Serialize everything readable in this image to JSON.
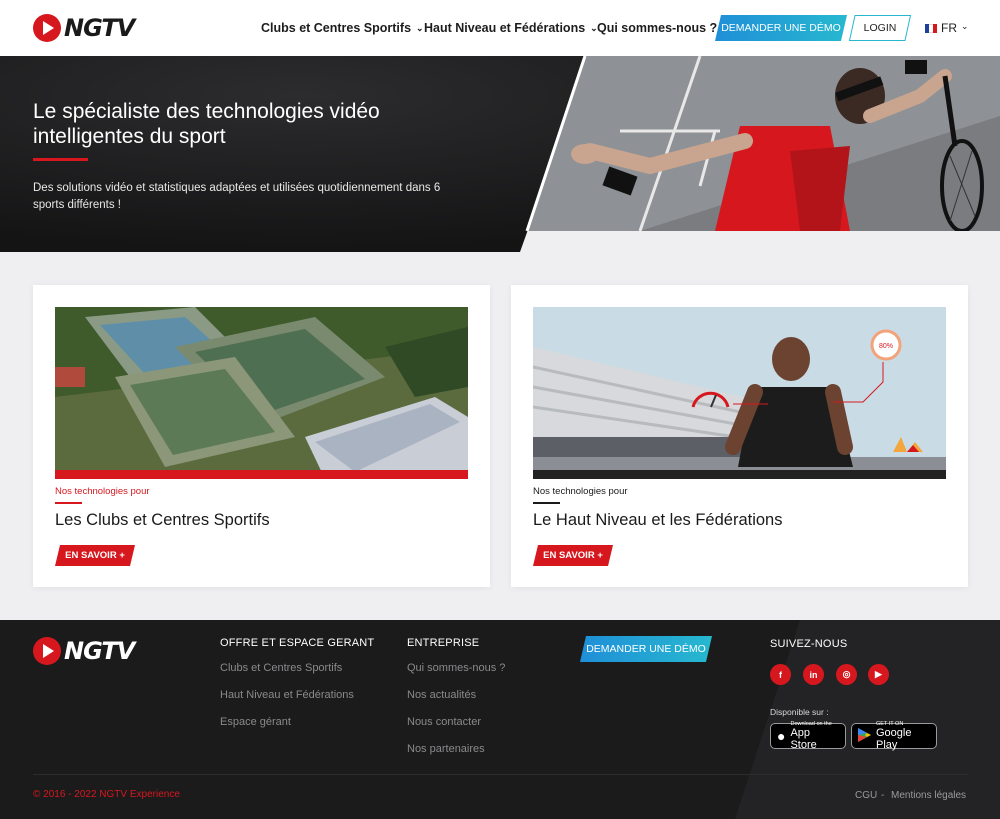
{
  "header": {
    "logo_text": "NGTV",
    "nav": [
      {
        "label": "Clubs et Centres Sportifs"
      },
      {
        "label": "Haut Niveau et Fédérations"
      },
      {
        "label": "Qui sommes-nous ?"
      }
    ],
    "demo_label": "DEMANDER UNE DÉMO",
    "login_label": "LOGIN",
    "language": "FR"
  },
  "hero": {
    "title": "Le spécialiste des technologies vidéo intelligentes du sport",
    "subtitle": "Des solutions vidéo et statistiques adaptées et utilisées quotidiennement dans 6 sports différents !"
  },
  "cards": [
    {
      "kicker": "Nos technologies pour",
      "title": "Les Clubs et Centres Sportifs",
      "button": "EN SAVOIR +"
    },
    {
      "kicker": "Nos technologies pour",
      "title": "Le Haut Niveau et les Fédérations",
      "button": "EN SAVOIR +",
      "gauge_label": "80%"
    }
  ],
  "footer": {
    "logo_text": "NGTV",
    "offre": {
      "heading": "OFFRE ET ESPACE GERANT",
      "links": [
        "Clubs et Centres Sportifs",
        "Haut Niveau et Fédérations",
        "Espace gérant"
      ]
    },
    "entreprise": {
      "heading": "ENTREPRISE",
      "links": [
        "Qui sommes-nous ?",
        "Nos actualités",
        "Nous contacter",
        "Nos partenaires"
      ]
    },
    "demo_label": "DEMANDER UNE DÉMO",
    "follow_heading": "SUIVEZ-NOUS",
    "social": [
      {
        "icon": "facebook-icon",
        "glyph": "f"
      },
      {
        "icon": "linkedin-icon",
        "glyph": "in"
      },
      {
        "icon": "instagram-icon",
        "glyph": "◎"
      },
      {
        "icon": "youtube-icon",
        "glyph": "▶"
      }
    ],
    "available_label": "Disponible sur :",
    "app_store": {
      "small": "Download on the",
      "big": "App Store"
    },
    "google_play": {
      "small": "GET IT ON",
      "big": "Google Play"
    },
    "copyright": "© 2016 - 2022 NGTV Experience",
    "legal_links": [
      "CGU",
      "-",
      "Mentions légales"
    ]
  },
  "colors": {
    "brand_red": "#d6181e",
    "demo_blue": "#1f8fd8",
    "dark": "#1b1b1c"
  }
}
